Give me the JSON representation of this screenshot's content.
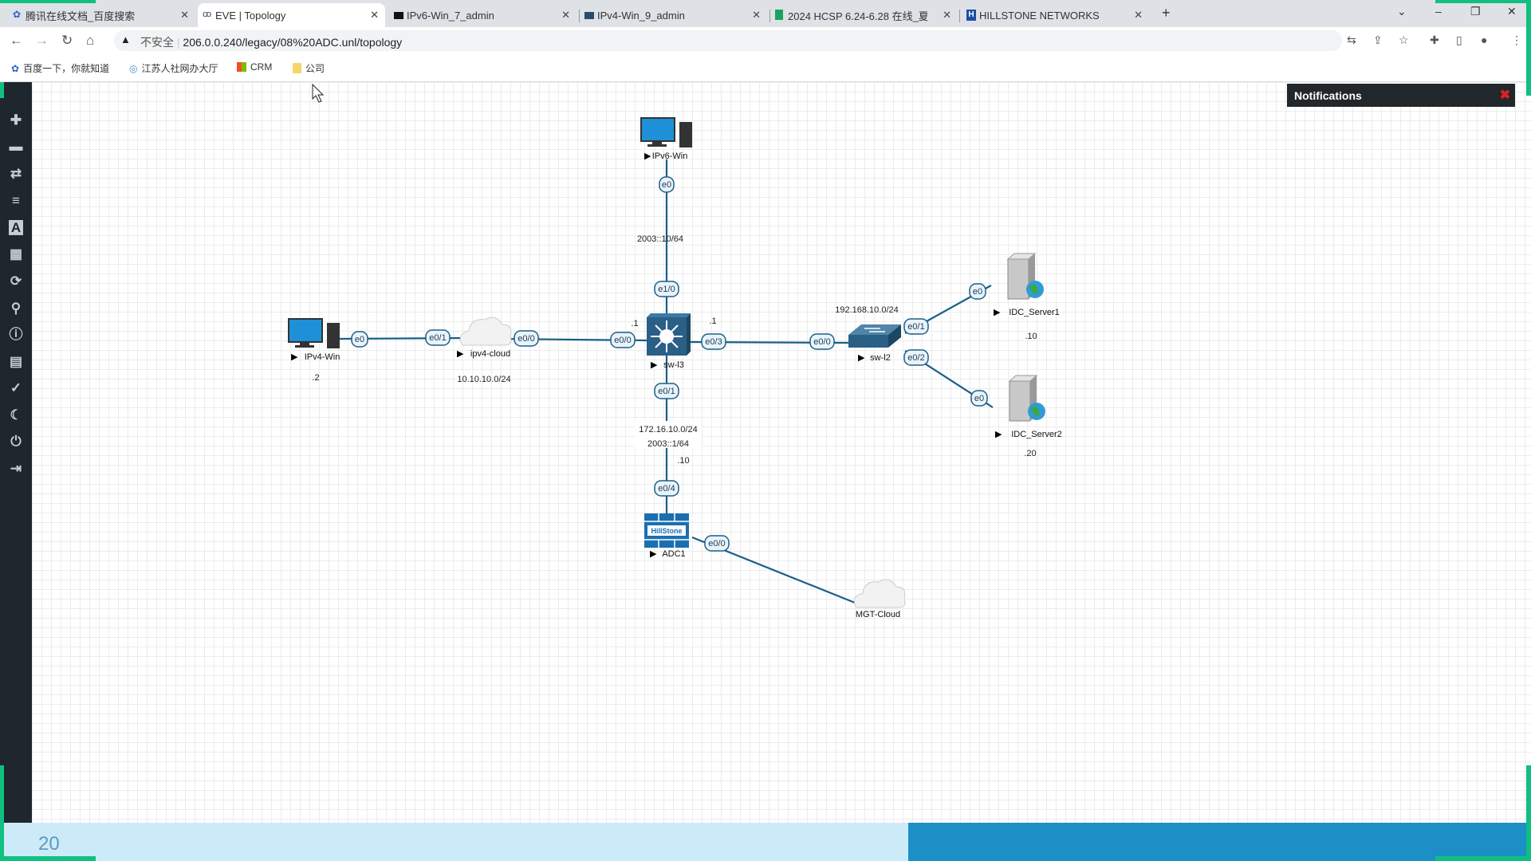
{
  "browser": {
    "tabs": [
      {
        "label": "腾讯在线文档_百度搜索",
        "active": false
      },
      {
        "label": "EVE | Topology",
        "active": true
      },
      {
        "label": "IPv6-Win_7_admin",
        "active": false
      },
      {
        "label": "IPv4-Win_9_admin",
        "active": false
      },
      {
        "label": "2024 HCSP 6.24-6.28 在线_夏…",
        "active": false
      },
      {
        "label": "HILLSTONE NETWORKS",
        "active": false
      }
    ],
    "new_tab": "+",
    "security_label": "不安全",
    "url": "206.0.0.240/legacy/08%20ADC.unl/topology",
    "bookmarks": [
      {
        "label": "百度一下，你就知道"
      },
      {
        "label": "江苏人社网办大厅"
      },
      {
        "label": "CRM"
      },
      {
        "label": "公司"
      }
    ]
  },
  "sidebar": {
    "icons": [
      "add-icon",
      "node-icon",
      "link-icon",
      "list-icon",
      "text-icon",
      "grid-icon",
      "refresh-icon",
      "zoom-icon",
      "info-icon",
      "log-icon",
      "check-icon",
      "moon-icon",
      "power-icon",
      "logout-icon"
    ]
  },
  "notifications": {
    "title": "Notifications",
    "close": "✖"
  },
  "topology": {
    "nodes": {
      "ipv6_win": "IPv6-Win",
      "ipv4_win": "IPv4-Win",
      "ipv4_cloud": "ipv4-cloud",
      "sw_l3": "sw-l3",
      "sw_l2": "sw-l2",
      "idc1": "IDC_Server1",
      "idc2": "IDC_Server2",
      "adc1": "ADC1",
      "mgt": "MGT-Cloud",
      "adc_logo": "HillStone"
    },
    "ports": {
      "ipv6_e0": "e0",
      "swl3_e10": "e1/0",
      "ipv4_e0": "e0",
      "cloud_e01": "e0/1",
      "cloud_e00": "e0/0",
      "swl3_e00": "e0/0",
      "swl3_e03": "e0/3",
      "swl2_e00": "e0/0",
      "swl2_e01": "e0/1",
      "swl2_e02": "e0/2",
      "idc1_e0": "e0",
      "idc2_e0": "e0",
      "swl3_e01": "e0/1",
      "adc_e04": "e0/4",
      "adc_e00": "e0/0"
    },
    "labels": {
      "ipv6_net": "2003::10/64",
      "swl3_left": ".1",
      "swl3_right": ".1",
      "ipv4_host": ".2",
      "ipv4_net": "10.10.10.0/24",
      "lan_net": "192.168.10.0/24",
      "idc1_host": ".10",
      "idc2_host": ".20",
      "adc_net4": "172.16.10.0/24",
      "adc_net6": "2003::1/64",
      "adc_host": ".10"
    }
  },
  "footer": {
    "page": "20"
  },
  "colors": {
    "link": "#1a5e8a",
    "sidebar": "#1f272e",
    "footer_light": "#cdeaf8",
    "footer_dark": "#1b8fc6"
  }
}
